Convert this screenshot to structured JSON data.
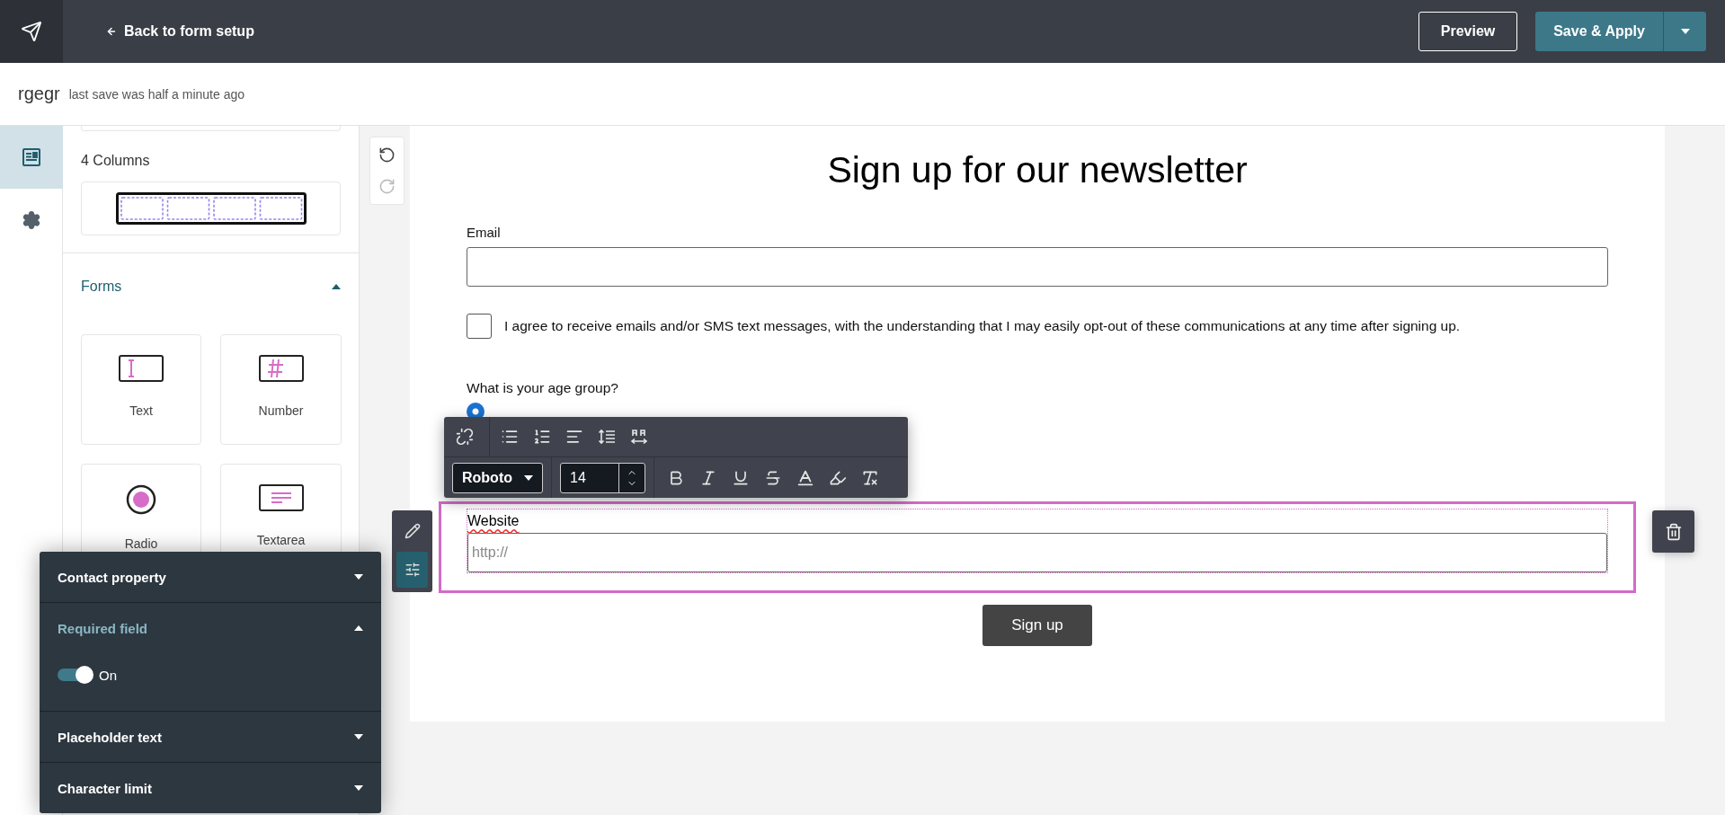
{
  "top_bar": {
    "back_link": "Back to form setup",
    "preview_button": "Preview",
    "save_button": "Save & Apply"
  },
  "document": {
    "name": "rgegr",
    "save_status": "last save was half a minute ago"
  },
  "rail": [
    {
      "kind": "blocks",
      "selected": true
    },
    {
      "kind": "settings",
      "selected": false
    }
  ],
  "layout_section": {
    "label": "4 Columns"
  },
  "forms_section": {
    "title": "Forms",
    "expanded": true,
    "tiles": [
      {
        "kind": "text",
        "label": "Text"
      },
      {
        "kind": "number",
        "label": "Number"
      },
      {
        "kind": "radio",
        "label": "Radio"
      },
      {
        "kind": "textarea",
        "label": "Textarea"
      }
    ]
  },
  "history": [
    {
      "kind": "undo",
      "disabled": false
    },
    {
      "kind": "redo",
      "disabled": true
    }
  ],
  "form": {
    "title": "Sign up for our newsletter",
    "email_label": "Email",
    "consent_text": "I agree to receive emails and/or SMS text messages, with the understanding that I may easily opt-out of these communications at any time after signing up.",
    "consent_checked": false,
    "age_question": "What is your age group?",
    "age_option_selected": true,
    "selected_field": {
      "label": "Website",
      "placeholder": "http://"
    },
    "submit_button": "Sign up"
  },
  "text_toolbar": {
    "font": "Roboto",
    "size": "14"
  },
  "settings_panel": {
    "sections": [
      {
        "title": "Contact property",
        "expanded": false
      },
      {
        "title": "Required field",
        "expanded": true,
        "toggle_on": true,
        "toggle_label": "On"
      },
      {
        "title": "Placeholder text",
        "expanded": false
      },
      {
        "title": "Character limit",
        "expanded": false
      }
    ]
  }
}
